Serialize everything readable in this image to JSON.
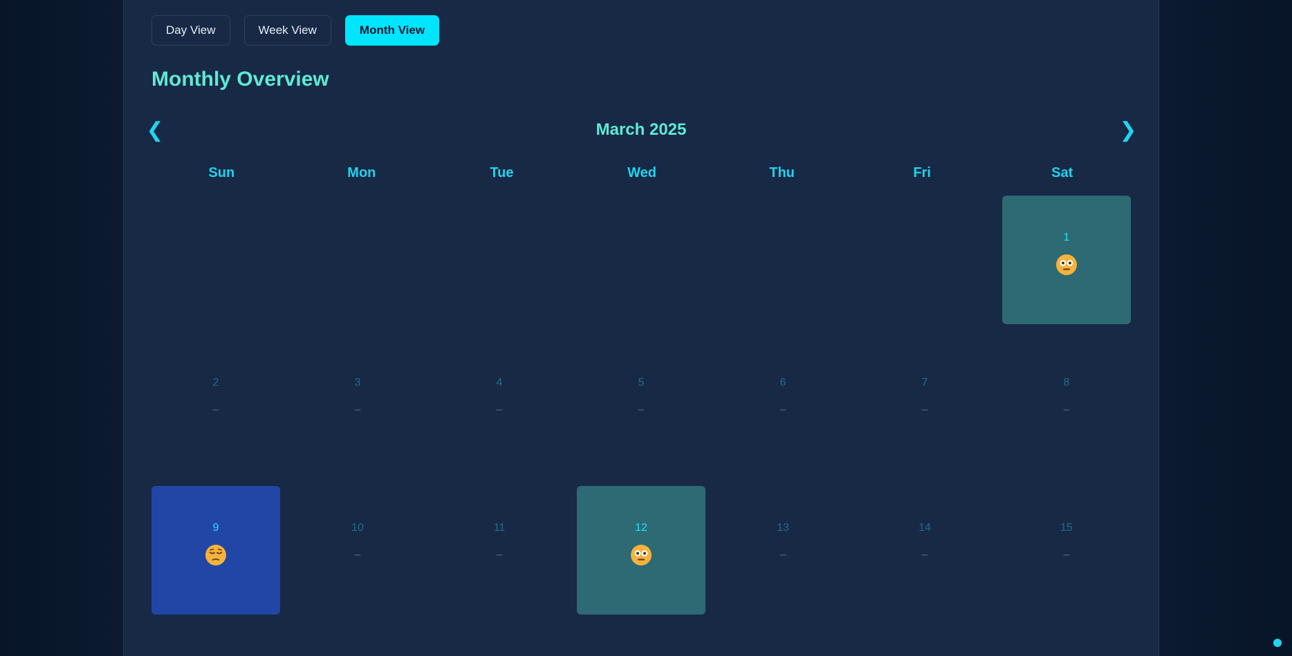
{
  "views": {
    "day": "Day View",
    "week": "Week View",
    "month": "Month View",
    "active": "month"
  },
  "title": "Monthly Overview",
  "calendar": {
    "month_label": "March 2025",
    "prev_symbol": "❮",
    "next_symbol": "❯",
    "weekdays": [
      "Sun",
      "Mon",
      "Tue",
      "Wed",
      "Thu",
      "Fri",
      "Sat"
    ],
    "empty_mood": "–",
    "days": [
      {
        "day": "",
        "mood": null
      },
      {
        "day": "",
        "mood": null
      },
      {
        "day": "",
        "mood": null
      },
      {
        "day": "",
        "mood": null
      },
      {
        "day": "",
        "mood": null
      },
      {
        "day": "",
        "mood": null
      },
      {
        "day": "1",
        "mood": "flushed"
      },
      {
        "day": "2",
        "mood": null
      },
      {
        "day": "3",
        "mood": null
      },
      {
        "day": "4",
        "mood": null
      },
      {
        "day": "5",
        "mood": null
      },
      {
        "day": "6",
        "mood": null
      },
      {
        "day": "7",
        "mood": null
      },
      {
        "day": "8",
        "mood": null
      },
      {
        "day": "9",
        "mood": "pensive"
      },
      {
        "day": "10",
        "mood": null
      },
      {
        "day": "11",
        "mood": null
      },
      {
        "day": "12",
        "mood": "flushed"
      },
      {
        "day": "13",
        "mood": null
      },
      {
        "day": "14",
        "mood": null
      },
      {
        "day": "15",
        "mood": null
      }
    ]
  },
  "mood_colors": {
    "flushed": "#2d6a73",
    "pensive": "#2246a6"
  },
  "accent": "#00e5ff",
  "brand_text": "#5eead4"
}
